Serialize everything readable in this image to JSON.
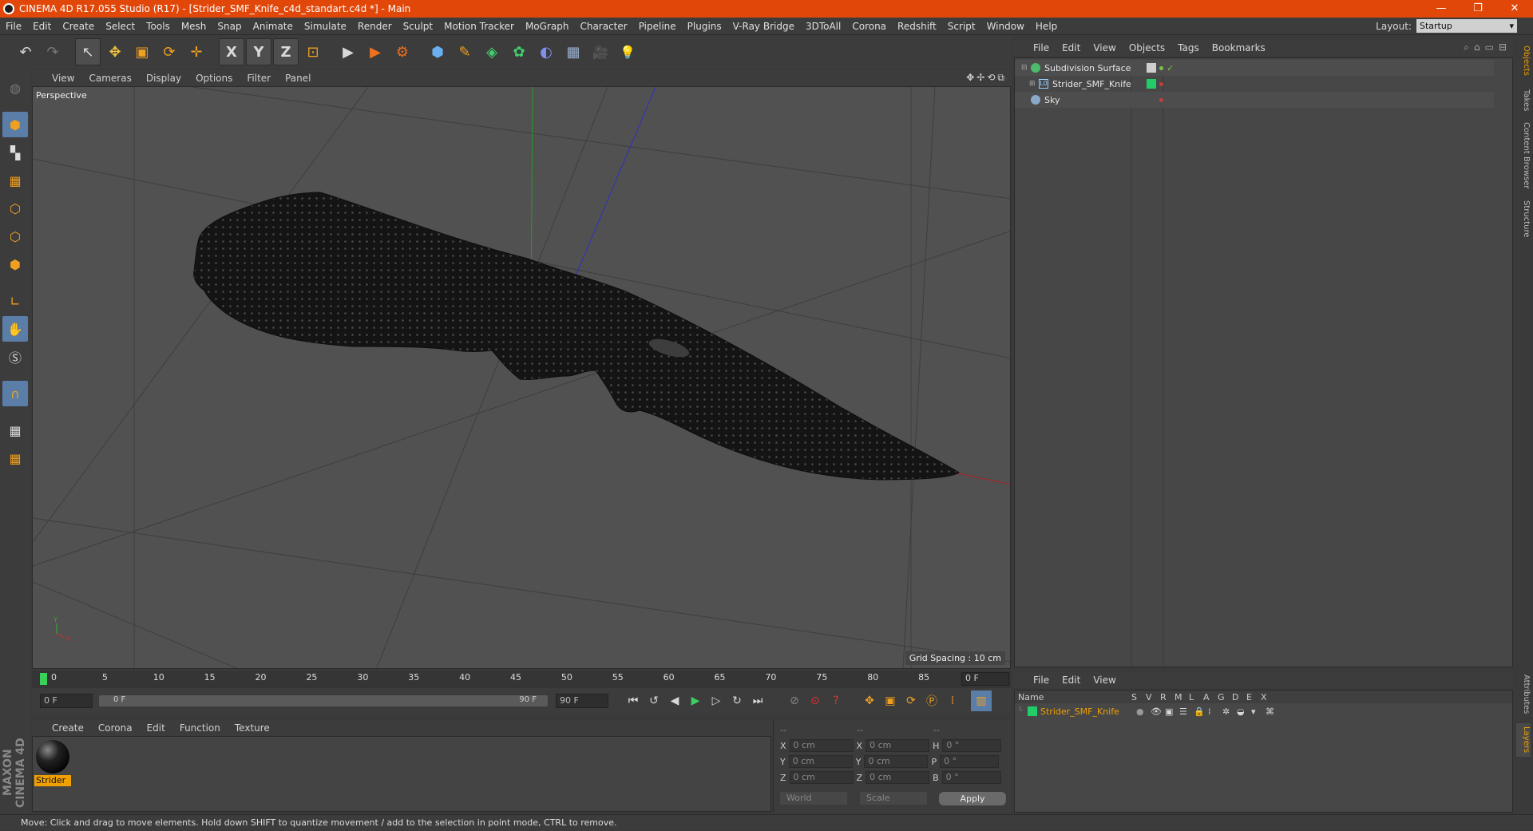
{
  "window": {
    "title": "CINEMA 4D R17.055 Studio (R17) - [Strider_SMF_Knife_c4d_standart.c4d *] - Main",
    "minimize": "—",
    "maximize": "❐",
    "close": "✕"
  },
  "menubar": {
    "items": [
      "File",
      "Edit",
      "Create",
      "Select",
      "Tools",
      "Mesh",
      "Snap",
      "Animate",
      "Simulate",
      "Render",
      "Sculpt",
      "Motion Tracker",
      "MoGraph",
      "Character",
      "Pipeline",
      "Plugins",
      "V-Ray Bridge",
      "3DToAll",
      "Corona",
      "Redshift",
      "Script",
      "Window",
      "Help"
    ],
    "layout_label": "Layout:",
    "layout_value": "Startup"
  },
  "toolbar": {
    "undo": "↶",
    "redo": "↷",
    "live_select": "↖",
    "move": "✥",
    "scale": "▣",
    "rotate": "⟳",
    "recent": "✛",
    "x_axis": "X",
    "y_axis": "Y",
    "z_axis": "Z",
    "coord_system": "⊡",
    "render_view": "▶",
    "render_region": "▶",
    "render_settings": "⚙",
    "cube": "⬢",
    "pen": "✎",
    "subdiv": "◈",
    "cloner": "✿",
    "deformer": "◐",
    "floor": "▦",
    "camera": "🎥",
    "light": "💡"
  },
  "viewport": {
    "menu": [
      "View",
      "Cameras",
      "Display",
      "Options",
      "Filter",
      "Panel"
    ],
    "label": "Perspective",
    "grid_spacing": "Grid Spacing : 10 cm"
  },
  "timeline": {
    "ticks": [
      "0",
      "5",
      "10",
      "15",
      "20",
      "25",
      "30",
      "35",
      "40",
      "45",
      "50",
      "55",
      "60",
      "65",
      "70",
      "75",
      "80",
      "85",
      "90"
    ],
    "current_frame": "0 F",
    "start": "0 F",
    "range_start": "0 F",
    "range_end": "90 F",
    "end": "90 F"
  },
  "material_manager": {
    "menu": [
      "Create",
      "Corona",
      "Edit",
      "Function",
      "Texture"
    ],
    "material_name": "Strider"
  },
  "coordinates": {
    "headers": [
      "--",
      "--",
      "--"
    ],
    "rows": [
      {
        "a": "X",
        "av": "0 cm",
        "b": "X",
        "bv": "0 cm",
        "c": "H",
        "cv": "0 °"
      },
      {
        "a": "Y",
        "av": "0 cm",
        "b": "Y",
        "bv": "0 cm",
        "c": "P",
        "cv": "0 °"
      },
      {
        "a": "Z",
        "av": "0 cm",
        "b": "Z",
        "bv": "0 cm",
        "c": "B",
        "cv": "0 °"
      }
    ],
    "mode_world": "World",
    "mode_scale": "Scale",
    "apply": "Apply"
  },
  "object_manager": {
    "menu": [
      "File",
      "Edit",
      "View",
      "Objects",
      "Tags",
      "Bookmarks"
    ],
    "objects": [
      {
        "name": "Subdivision Surface",
        "color": "#4dbb6a"
      },
      {
        "name": "Strider_SMF_Knife",
        "color": "#9ad0ff"
      },
      {
        "name": "Sky",
        "color": "#8aa8c8"
      }
    ]
  },
  "layer_manager": {
    "menu": [
      "File",
      "Edit",
      "View"
    ],
    "columns": [
      "Name",
      "S",
      "V",
      "R",
      "M",
      "L",
      "A",
      "G",
      "D",
      "E",
      "X"
    ],
    "layer_name": "Strider_SMF_Knife",
    "layer_color": "#22cc66"
  },
  "side_tabs": [
    "Objects",
    "Takes",
    "Content Browser",
    "Structure"
  ],
  "side_tabs_bottom": [
    "Attributes",
    "Layers"
  ],
  "status": "Move: Click and drag to move elements. Hold down SHIFT to quantize movement / add to the selection in point mode, CTRL to remove.",
  "branding": "MAXON CINEMA 4D"
}
